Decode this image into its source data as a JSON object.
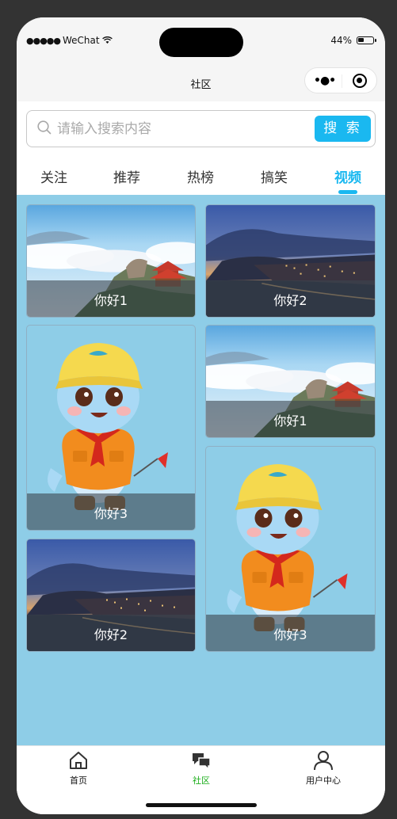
{
  "status_bar": {
    "carrier_dots": "●●●●●",
    "carrier": "WeChat",
    "battery_percent": "44%",
    "battery_level": 0.44
  },
  "nav": {
    "title": "社区",
    "menu_icon": "more-dots-icon",
    "close_icon": "target-circle-icon"
  },
  "search": {
    "placeholder": "请输入搜索内容",
    "value": "",
    "button_label": "搜 索"
  },
  "tabs": [
    {
      "label": "关注",
      "active": false
    },
    {
      "label": "推荐",
      "active": false
    },
    {
      "label": "热榜",
      "active": false
    },
    {
      "label": "搞笑",
      "active": false
    },
    {
      "label": "视频",
      "active": true
    }
  ],
  "cards": [
    {
      "title": "你好1",
      "image": "mountain-clouds-pavilion"
    },
    {
      "title": "你好2",
      "image": "coastal-city-dusk"
    },
    {
      "title": "你好3",
      "image": "dolphin-mascot-cartoon"
    },
    {
      "title": "你好1",
      "image": "mountain-clouds-pavilion"
    },
    {
      "title": "你好3",
      "image": "dolphin-mascot-cartoon"
    },
    {
      "title": "你好2",
      "image": "coastal-city-dusk"
    }
  ],
  "tabbar": [
    {
      "label": "首页",
      "icon": "home-icon",
      "active": false
    },
    {
      "label": "社区",
      "icon": "chat-bubbles-icon",
      "active": true
    },
    {
      "label": "用户中心",
      "icon": "user-icon",
      "active": false
    }
  ],
  "colors": {
    "accent": "#1ab8f0",
    "content_bg": "#8ecde7",
    "tabbar_active": "#1aad19"
  }
}
